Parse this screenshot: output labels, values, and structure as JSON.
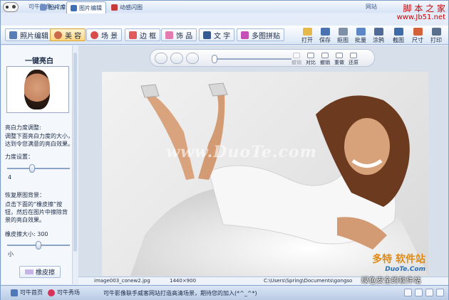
{
  "app": {
    "title": "可牛影像 v2.0.0.1003",
    "win_link": "网站"
  },
  "tabs": [
    {
      "label": "图片库"
    },
    {
      "label": "图片编辑"
    },
    {
      "label": "动感闪图"
    }
  ],
  "watermark_top": {
    "line1": "脚 本 之 家",
    "line2": "www.Jb51.net"
  },
  "toolbar": {
    "items": [
      "照片编辑",
      "美 容",
      "场 景",
      "边 框",
      "饰 品",
      "文 字",
      "多图拼贴"
    ],
    "right_tools": [
      "打开",
      "保存",
      "抠图",
      "批量",
      "涂鸦",
      "截图",
      "尺寸",
      "打印"
    ]
  },
  "sidebar": {
    "heading": "一键亮白",
    "desc_title": "亮白力度调整:",
    "desc_lines": [
      "调整下面亮白力度的大小，",
      "达到令您满意的亮白效果。"
    ],
    "strength_label": "力度设置：",
    "strength_value": "4",
    "strength_level": 0.35,
    "restore_title": "恢复原图背景：",
    "restore_lines": [
      "点击下面的“橡皮擦”按",
      "钮，然后在图片中擦除背",
      "景的亮白效果。"
    ],
    "eraser_size_label": "橡皮擦大小: 300",
    "eraser_size_min": "小",
    "eraser_size_level": 0.45,
    "eraser_button": "橡皮擦"
  },
  "canvas_tools": [
    "撤销",
    "重做",
    "对比",
    "撤销",
    "重做",
    "还原"
  ],
  "photo": {
    "watermark": "www.DuoTe.com",
    "corner_brand": "多特 软件站",
    "corner_url": "DuoTe.Com"
  },
  "status": {
    "filename": "image003_conew2.jpg",
    "dimensions": "1440×900",
    "path": "C:\\Users\\Spring\\Documents\\gongso"
  },
  "bottom": {
    "home": "可牛首页",
    "show": "可牛秀场",
    "ad": "可牛影像联手威客网站打造高清场景，期待您的加入(*^_^*)",
    "overlay_text": "绿色安全的软件站"
  },
  "colors": {
    "accent": "#ffd67e",
    "brand_orange": "#e08a12",
    "watermark_red": "#cc0000"
  }
}
